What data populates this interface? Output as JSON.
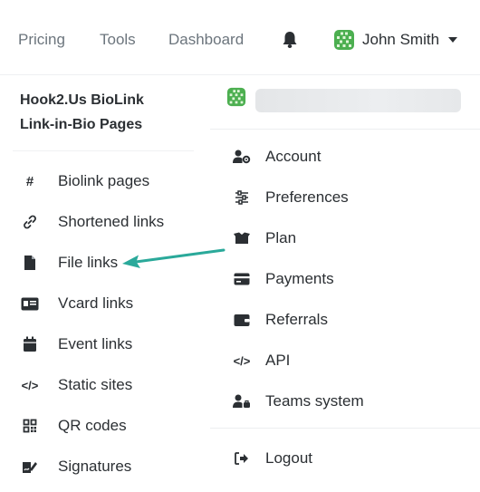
{
  "navbar": {
    "links": [
      "Pricing",
      "Tools",
      "Dashboard"
    ],
    "bell_icon": "bell-icon",
    "user_name": "John Smith",
    "avatar_icon": "avatar-grid-icon",
    "dropdown_icon": "caret-down-icon"
  },
  "sidebar": {
    "brand_line1": "Hook2.Us BioLink",
    "brand_line2": "Link-in-Bio Pages",
    "items": [
      {
        "label": "Biolink pages",
        "icon": "hash-icon"
      },
      {
        "label": "Shortened links",
        "icon": "link-icon"
      },
      {
        "label": "File links",
        "icon": "file-icon"
      },
      {
        "label": "Vcard links",
        "icon": "id-card-icon"
      },
      {
        "label": "Event links",
        "icon": "calendar-icon"
      },
      {
        "label": "Static sites",
        "icon": "code-icon"
      },
      {
        "label": "QR codes",
        "icon": "qr-code-icon"
      },
      {
        "label": "Signatures",
        "icon": "signature-icon"
      }
    ]
  },
  "dropdown": {
    "items": [
      {
        "label": "Account",
        "icon": "user-cog-icon"
      },
      {
        "label": "Preferences",
        "icon": "sliders-icon"
      },
      {
        "label": "Plan",
        "icon": "box-icon"
      },
      {
        "label": "Payments",
        "icon": "credit-card-icon"
      },
      {
        "label": "Referrals",
        "icon": "wallet-icon"
      },
      {
        "label": "API",
        "icon": "code-icon"
      },
      {
        "label": "Teams system",
        "icon": "user-tie-icon"
      }
    ],
    "logout_label": "Logout",
    "logout_icon": "sign-out-icon"
  },
  "colors": {
    "text": "#2b2f33",
    "muted": "#6c757d",
    "annotation_arrow": "#2aa99a",
    "avatar": "#4caf50"
  }
}
